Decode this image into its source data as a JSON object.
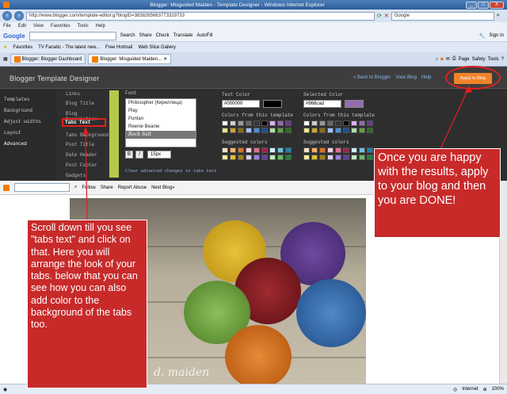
{
  "window": {
    "title": "Blogger: Misguided Maiden - Template Designer - Windows Internet Explorer",
    "min": "_",
    "max": "□",
    "close": "X"
  },
  "address": {
    "url": "http://www.blogger.com/template-editor.g?blogID=3838265663773329733",
    "search_placeholder": "Google"
  },
  "menubar": [
    "File",
    "Edit",
    "View",
    "Favorites",
    "Tools",
    "Help"
  ],
  "gbar": {
    "label": "Google",
    "search": "Search",
    "share": "Share",
    "check": "Check",
    "translate": "Translate",
    "autofill": "AutoFill",
    "signin": "Sign In"
  },
  "favbar": {
    "favorites": "Favorites",
    "items": [
      "TV Fanatic - The latest new...",
      "Free Hotmail",
      "Web Slice Gallery"
    ]
  },
  "tabs": [
    "Blogger: Blogger Dashboard",
    "Blogger: Misguided Maiden..."
  ],
  "toolbar_right": {
    "page": "Page",
    "safety": "Safety",
    "tools": "Tools"
  },
  "designer": {
    "title": "Blogger Template Designer",
    "back": "« Back to Blogger",
    "view": "View Blog",
    "help": "Help",
    "apply": "Apply to Blog",
    "left_nav": [
      "Templates",
      "Background",
      "Adjust widths",
      "Layout",
      "Advanced"
    ],
    "sub_nav": [
      "Links",
      "Blog Title",
      "Blog Description",
      "Tabs Text",
      "Tabs Background",
      "Post Title",
      "Date Header",
      "Post Footer",
      "Gadgets"
    ],
    "font_label": "Font",
    "fonts": [
      "Philosopher (Кириллица)",
      "Play",
      "Puritan",
      "Rock Salt",
      "Rock Salt"
    ],
    "fonts_visible": [
      "Philosopher (Кириллица)",
      "Play",
      "Puritan",
      "Reenie Beanie",
      "Rock Salt"
    ],
    "bold": "B",
    "italic": "I",
    "size": "15px",
    "text_color_label": "Text Color",
    "text_color_value": "#000000",
    "colors_from_template": "Colors from this template",
    "suggested": "Suggested colors",
    "selected_color_label": "Selected Color",
    "selected_color_value": "#966cad",
    "clear": "Clear advanced changes to tabs text"
  },
  "blogbar": {
    "follow": "Follow",
    "share": "Share",
    "report": "Report Abuse",
    "next": "Next Blog»"
  },
  "photo_watermark": "d. maiden",
  "status": {
    "internet": "Internet",
    "zoom": "100%"
  },
  "callouts": {
    "apply": "Once you are happy with the results, apply to your blog and then you are DONE!",
    "scroll": "Scroll down till you see \"tabs text\" and click on that. Here you will arrange the look of your tabs. below that you can see how you can also add color to the background of the tabs too."
  },
  "colors": {
    "accent": "#f0832a",
    "callout": "#c82a2a",
    "designer_bg": "#2e2e2e",
    "selected": "#966cad"
  },
  "template_swatches_row1": [
    "#ffffff",
    "#cccccc",
    "#999999",
    "#666666",
    "#333333",
    "#000000",
    "#e0b0ff",
    "#966cad",
    "#6a3d8a"
  ],
  "template_swatches_row2": [
    "#f0e68c",
    "#cda434",
    "#8b6914",
    "#a0c4ff",
    "#4a90d9",
    "#1c4f8f",
    "#b0e0a0",
    "#5fa040",
    "#2e6b1e"
  ],
  "suggested_row1": [
    "#ffe0c0",
    "#ffb070",
    "#e07020",
    "#ffd0e0",
    "#e07090",
    "#a02050",
    "#d0f0ff",
    "#70c0e0",
    "#2080b0"
  ],
  "suggested_row2": [
    "#fff0a0",
    "#e0c030",
    "#a08010",
    "#e0d0ff",
    "#a080e0",
    "#6040a0",
    "#c0f0c0",
    "#60c060",
    "#208040"
  ]
}
